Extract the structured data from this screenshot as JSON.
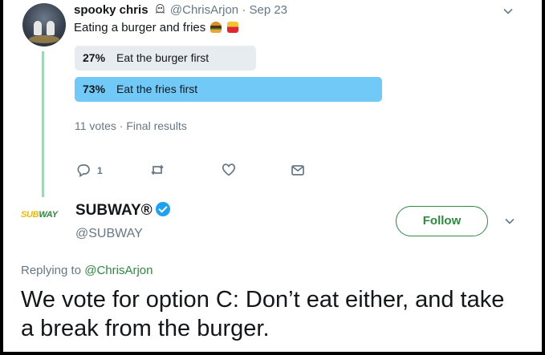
{
  "original_tweet": {
    "author_name": "spooky chris",
    "author_icon": "ghost-icon",
    "handle": "@ChrisArjon",
    "date_separator": "·",
    "date": "Sep 23",
    "text": "Eating a burger and fries",
    "emojis": [
      "burger-emoji",
      "fries-emoji"
    ],
    "poll": {
      "options": [
        {
          "percent_label": "27%",
          "percent": 27,
          "label": "Eat the burger first",
          "color": "#e6ecf0"
        },
        {
          "percent_label": "73%",
          "percent": 73,
          "label": "Eat the fries first",
          "color": "#71c9f8"
        }
      ],
      "votes": "11 votes",
      "separator": "·",
      "status": "Final results"
    },
    "actions": {
      "reply_count": "1",
      "icons": [
        "reply-icon",
        "retweet-icon",
        "like-icon",
        "message-icon"
      ]
    }
  },
  "reply_tweet": {
    "logo_text_part1": "SUB",
    "logo_text_part2": "WAY",
    "logo_colors": {
      "yellow": "#f2b700",
      "green": "#2d8a3e"
    },
    "author_name": "SUBWAY®",
    "verified": true,
    "handle": "@SUBWAY",
    "follow_label": "Follow",
    "replying_to_prefix": "Replying to",
    "replying_to_handle": "@ChrisArjon",
    "text": "We vote for option C: Don’t eat either, and take a break from the burger."
  },
  "colors": {
    "thread_line": "#9ed7b5",
    "muted_text": "#657786",
    "brand_green": "#2d8a3e",
    "verified_blue": "#1da1f2"
  }
}
